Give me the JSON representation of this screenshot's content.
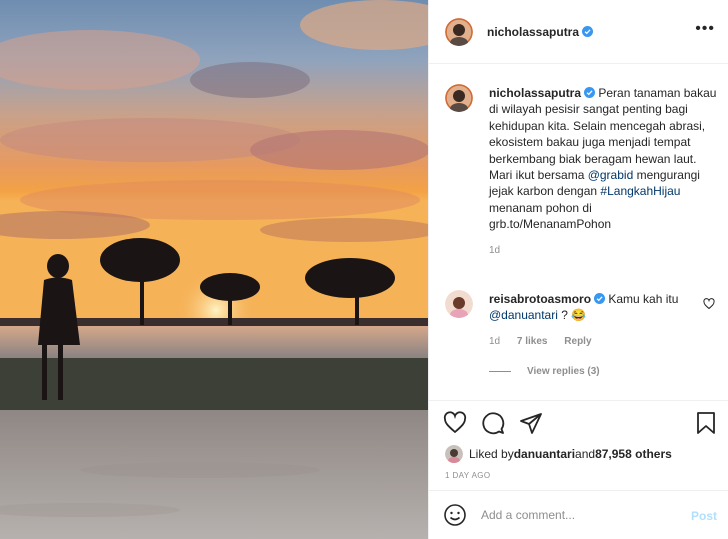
{
  "post": {
    "author": "nicholassaputra",
    "caption_pre": " Peran tanaman bakau di wilayah pesisir sangat penting bagi kehidupan kita. Selain mencegah abrasi, ekosistem bakau juga menjadi tempat berkembang biak beragam hewan laut. Mari ikut bersama ",
    "mention": "@grabid",
    "caption_mid": " mengurangi jejak karbon dengan ",
    "hashtag": "#LangkahHijau",
    "caption_post": " menanam pohon di grb.to/MenanamPohon",
    "caption_age": "1d"
  },
  "comment": {
    "author": "reisabrotoasmoro",
    "text_pre": " Kamu kah itu ",
    "mention": "@danuantari",
    "text_post": " ? 😂",
    "age": "1d",
    "likes": "7 likes",
    "reply": "Reply",
    "view_replies": "View replies (3)"
  },
  "likes": {
    "prefix": "Liked by ",
    "liker": "danuantari",
    "middle": " and ",
    "others": "87,958 others"
  },
  "date": "1 DAY AGO",
  "add_comment": {
    "placeholder": "Add a comment...",
    "post_label": "Post"
  },
  "colors": {
    "link": "#00376b",
    "verified": "#3897f0",
    "post_disabled": "#b2dffc",
    "muted": "#8e8e8e"
  },
  "icons": [
    "more-icon",
    "verified-badge-icon",
    "heart-icon",
    "comment-icon",
    "share-icon",
    "bookmark-icon",
    "emoji-icon"
  ]
}
